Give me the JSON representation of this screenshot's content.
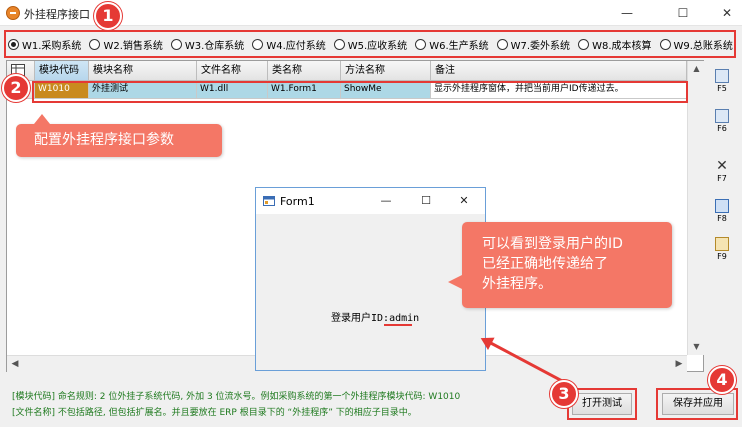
{
  "window": {
    "title": "外挂程序接口",
    "min_glyph": "—",
    "max_glyph": "☐",
    "close_glyph": "✕"
  },
  "subsystems": [
    {
      "label": "W1.采购系统",
      "selected": true
    },
    {
      "label": "W2.销售系统",
      "selected": false
    },
    {
      "label": "W3.仓库系统",
      "selected": false
    },
    {
      "label": "W4.应付系统",
      "selected": false
    },
    {
      "label": "W5.应收系统",
      "selected": false
    },
    {
      "label": "W6.生产系统",
      "selected": false
    },
    {
      "label": "W7.委外系统",
      "selected": false
    },
    {
      "label": "W8.成本核算",
      "selected": false
    },
    {
      "label": "W9.总账系统",
      "selected": false
    }
  ],
  "grid": {
    "columns": [
      "模块代码",
      "模块名称",
      "文件名称",
      "类名称",
      "方法名称",
      "备注"
    ],
    "rows": [
      {
        "code": "W1010",
        "name": "外挂测试",
        "file": "W1.dll",
        "class": "W1.Form1",
        "method": "ShowMe",
        "note": "显示外挂程序窗体，并把当前用户ID传递过去。"
      }
    ]
  },
  "annotations": {
    "n1": "1",
    "n2": "2",
    "n3": "3",
    "n4": "4",
    "callout1": "配置外挂程序接口参数",
    "callout2_lines": [
      "可以看到登录用户的ID",
      "已经正确地传递给了",
      "外挂程序。"
    ],
    "color": "#e53935",
    "callout_color": "#f47766"
  },
  "form1": {
    "title": "Form1",
    "user_label": "登录用户ID:",
    "user_value": "admin",
    "min_glyph": "—",
    "max_glyph": "☐",
    "close_glyph": "✕"
  },
  "toolbar": [
    {
      "key": "F5",
      "icon": "add-row-icon"
    },
    {
      "key": "F6",
      "icon": "insert-row-icon"
    },
    {
      "key": "F7",
      "icon": "delete-icon"
    },
    {
      "key": "F8",
      "icon": "copy-icon"
    },
    {
      "key": "F9",
      "icon": "paste-icon"
    }
  ],
  "info": {
    "line1": "[模块代码] 命名规则: 2 位外挂子系统代码, 外加 3 位流水号。例如采购系统的第一个外挂程序模块代码: W1010",
    "line2": "[文件名称] 不包括路径, 但包括扩展名。并且要放在 ERP 根目录下的 “外挂程序” 下的相应子目录中。"
  },
  "buttons": {
    "test": "打开测试",
    "save": "保存并应用"
  }
}
